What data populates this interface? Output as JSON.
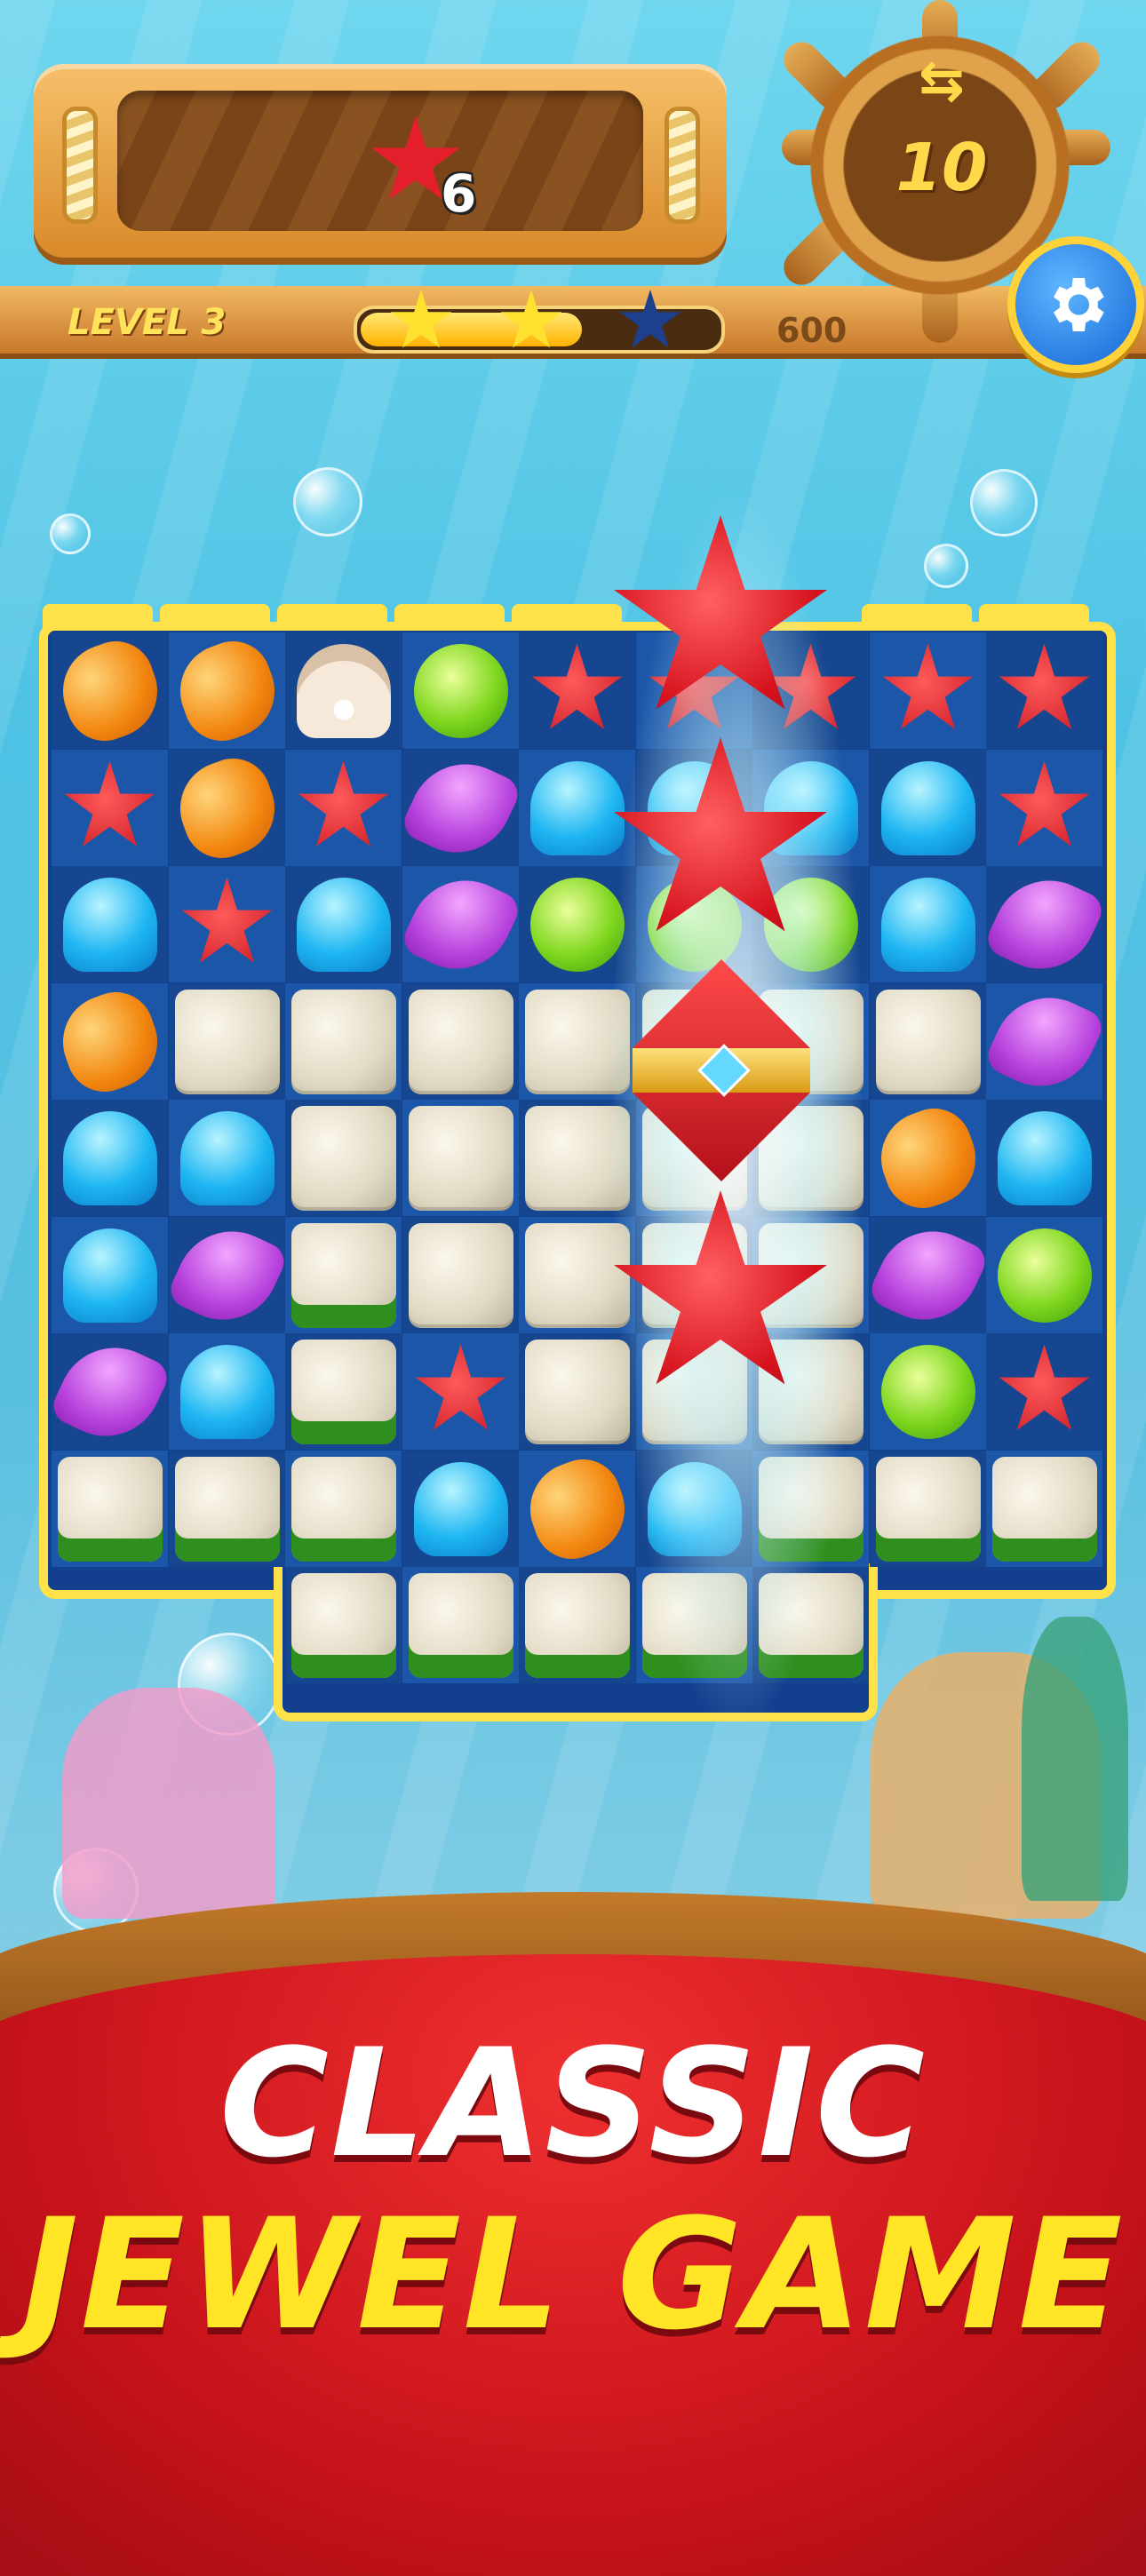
{
  "hud": {
    "goal_icon": "red-starfish-icon",
    "goal_count": "6",
    "moves_icon": "swap-arrows-icon",
    "moves_left": "10",
    "level_label": "LEVEL 3",
    "score_target": "600",
    "score_progress_fraction": 0.62,
    "stars_earned": 2,
    "stars_total": 3,
    "settings_icon": "gear-icon"
  },
  "colors": {
    "accent_yellow": "#ffe526",
    "banner_red": "#c8121a",
    "board_blue": "#123f8e",
    "settings_blue": "#1466d6"
  },
  "board": {
    "rows": [
      [
        "orange",
        "orange",
        "pearl",
        "green",
        "star",
        "star",
        "star",
        "star",
        "star"
      ],
      [
        "star",
        "orange",
        "star",
        "shell",
        "jelly",
        "jelly",
        "jelly",
        "jelly",
        "star"
      ],
      [
        "jelly",
        "star",
        "jelly",
        "shell",
        "green",
        "green",
        "green",
        "jelly",
        "shell"
      ],
      [
        "orange",
        "rock",
        "rock",
        "rock",
        "rock",
        "rock",
        "rock",
        "rock",
        "shell"
      ],
      [
        "jelly",
        "jelly",
        "rock",
        "rock",
        "rock",
        "rock",
        "rock",
        "orange",
        "jelly"
      ],
      [
        "jelly",
        "shell",
        "moss",
        "rock",
        "rock",
        "rock",
        "rock",
        "shell",
        "green"
      ],
      [
        "shell",
        "jelly",
        "moss",
        "star",
        "rock",
        "rock",
        "rock",
        "green",
        "star"
      ],
      [
        "moss",
        "moss",
        "moss",
        "jelly",
        "orange",
        "jelly",
        "moss",
        "moss",
        "moss"
      ],
      [
        "",
        "",
        "moss",
        "moss",
        "moss",
        "moss",
        "moss",
        "",
        ""
      ]
    ],
    "special_column_items": [
      "big-starfish",
      "big-starfish",
      "red-diamond-bomb",
      "big-starfish"
    ]
  },
  "banner": {
    "line1": "CLASSIC",
    "line2": "JEWEL GAME"
  }
}
